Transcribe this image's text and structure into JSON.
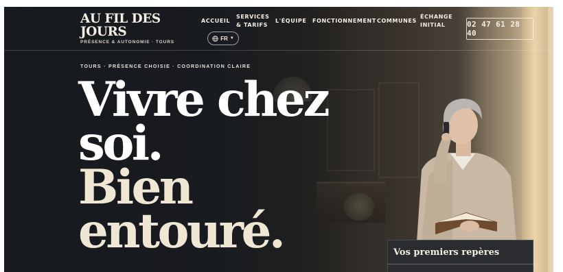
{
  "brand": {
    "name": "AU FIL DES JOURS",
    "tagline": "PRÉSENCE & AUTONOMIE · TOURS"
  },
  "nav": {
    "items": [
      {
        "id": "accueil",
        "line1": "ACCUEIL",
        "line2": ""
      },
      {
        "id": "services",
        "line1": "SERVICES",
        "line2": "& TARIFS"
      },
      {
        "id": "equipe",
        "line1": "L'ÉQUIPE",
        "line2": ""
      },
      {
        "id": "fonctionnement",
        "line1": "FONCTIONNEMENT",
        "line2": ""
      },
      {
        "id": "communes",
        "line1": "COMMUNES",
        "line2": ""
      },
      {
        "id": "echange",
        "line1": "ÉCHANGE",
        "line2": "INITIAL"
      }
    ],
    "language": "FR",
    "language_icon": "globe-icon",
    "phone": "02 47 61 28 40"
  },
  "hero": {
    "eyebrow": "TOURS · PRÉSENCE CHOISIE · COORDINATION CLAIRE",
    "headline": [
      "Vivre chez",
      "soi.",
      "Bien",
      "entouré."
    ]
  },
  "card": {
    "title": "Vos premiers repères"
  },
  "colors": {
    "background_dark": "#1e2126",
    "text_light": "#f4eee4",
    "accent_cream": "#efe6d4",
    "card_bg": "#2a2c30"
  }
}
